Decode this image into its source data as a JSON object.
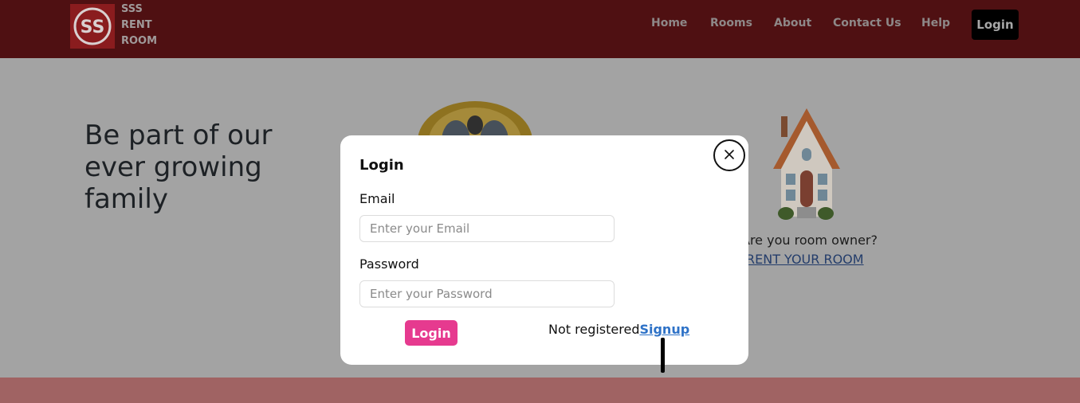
{
  "brand": {
    "line1": "SSS",
    "line2": "RENT",
    "line3": "ROOM"
  },
  "nav": {
    "items": [
      "Home",
      "Rooms",
      "About",
      "Contact Us",
      "Help"
    ],
    "login_label": "Login"
  },
  "hero": {
    "title": "Be part of our ever growing family",
    "owner_question": "Are you room owner?",
    "owner_link": "RENT YOUR ROOM"
  },
  "modal": {
    "title": "Login",
    "email_label": "Email",
    "email_placeholder": "Enter your Email",
    "password_label": "Password",
    "password_placeholder": "Enter your Password",
    "submit_label": "Login",
    "not_registered_text": "Not registered",
    "signup_link": "Signup"
  },
  "colors": {
    "navbar": "#4f1012",
    "overlay_bg": "#a3a3a3",
    "accent_button": "#e63a8f",
    "link": "#2e72c7",
    "footer_band": "#a06363"
  },
  "icons": [
    "logo-icon",
    "mascot-icon",
    "house-icon",
    "close-icon"
  ]
}
